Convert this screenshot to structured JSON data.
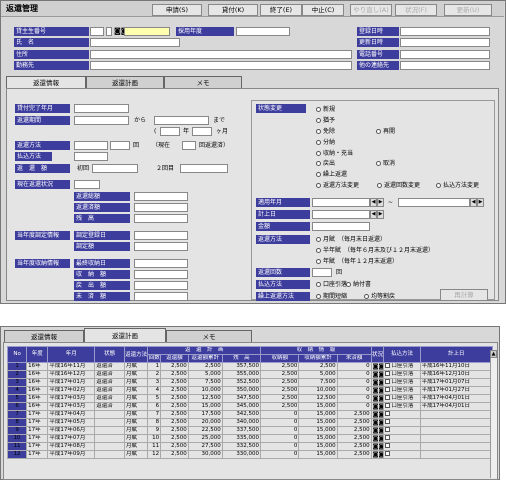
{
  "app": {
    "title": "返還管理"
  },
  "toolbar": {
    "apply": "申請(S)",
    "lend": "貸付(K)",
    "exit": "終了(E)",
    "cancel": "中止(C)",
    "redo": "やり直し(A)",
    "status": "状況(F)",
    "update": "更新(U)"
  },
  "header": {
    "student_no": "貸主生番号",
    "adoption_year": "採用年度",
    "name": "氏　名",
    "address": "住所",
    "workplace": "勤務先",
    "reg_date": "登録日時",
    "upd_date": "更新日時",
    "phone": "電話番号",
    "other_contact": "他の連絡先"
  },
  "tabs": [
    "返還情報",
    "返還計画",
    "メモ"
  ],
  "left": {
    "lend_end": "貸付完了年月",
    "period": "返還期間",
    "from": "から",
    "to": "まで",
    "year": "年",
    "month": "ヶ月",
    "method": "返還方法",
    "times_unit": "回",
    "current": "（現在",
    "current_suffix": "回返還済）",
    "pay_method": "払込方法",
    "amount": "返　還　額",
    "first": "初回",
    "second": "２回目",
    "status_head": "現在返還状況",
    "total": "返還総額",
    "paid": "返還済額",
    "balance": "残　高",
    "adjust_head": "当年度調定情報",
    "adjust_date": "調定登録日",
    "adjust_amt": "調定額",
    "collect_head": "当年度収納情報",
    "collect_date": "最終収納日",
    "collect_amt": "収　納　額",
    "refund_amt": "戻　出　額",
    "unpaid_amt": "未　済　額"
  },
  "right": {
    "change_head": "状態変更",
    "options": [
      "新規",
      "猶予",
      "免除",
      "再開",
      "分納",
      "収納・充当",
      "戻出",
      "取消",
      "繰上返還"
    ],
    "checks": [
      "返還方法変更",
      "返還回数変更",
      "払込方法変更"
    ],
    "apply_ym": "適用年月",
    "calc_date": "計上日",
    "amount": "金額",
    "method": "返還方法",
    "method_opts": [
      "月賦　（毎月末日返還）",
      "半年賦　（毎年６月末及び１２月末返還）",
      "年賦　（毎年１２月末返還）"
    ],
    "count": "返還回数",
    "count_unit": "回",
    "pay_method": "払込方法",
    "pay_opts": [
      "口座引落",
      "納付書"
    ],
    "early_method": "繰上返還方法",
    "early_opts": [
      "期間短縮",
      "均等割戻"
    ],
    "recalc": "再計算"
  },
  "grid": {
    "tabs": [
      "返還情報",
      "返還計画",
      "メモ"
    ],
    "head1": [
      "No",
      "年度",
      "年月",
      "状態",
      "返還方法",
      "返　還　計　画",
      "収　納　情　報",
      "状況",
      "払込方法",
      "計上日"
    ],
    "head2": [
      "回数",
      "返還額",
      "返還額累計",
      "残　高",
      "収納額",
      "収納額累計",
      "未済額"
    ],
    "rows": [
      [
        "1",
        "16年",
        "平成16年11月",
        "返還済",
        "月賦",
        "1",
        "2,500",
        "2,500",
        "357,500",
        "2,500",
        "2,500",
        "0",
        "口座引落",
        "平成16年11月10日"
      ],
      [
        "2",
        "16年",
        "平成16年12月",
        "返還済",
        "月賦",
        "2",
        "2,500",
        "5,000",
        "355,000",
        "2,500",
        "5,000",
        "0",
        "口座引落",
        "平成16年12月10日"
      ],
      [
        "3",
        "16年",
        "平成17年01月",
        "返還済",
        "月賦",
        "3",
        "2,500",
        "7,500",
        "352,500",
        "2,500",
        "7,500",
        "0",
        "口座引落",
        "平成17年01月07日"
      ],
      [
        "4",
        "16年",
        "平成17年02月",
        "返還済",
        "月賦",
        "4",
        "2,500",
        "10,000",
        "350,000",
        "2,500",
        "10,000",
        "0",
        "口座引落",
        "平成17年01月27日"
      ],
      [
        "5",
        "16年",
        "平成17年03月",
        "返還済",
        "月賦",
        "5",
        "2,500",
        "12,500",
        "347,500",
        "2,500",
        "12,500",
        "0",
        "口座引落",
        "平成17年04月01日"
      ],
      [
        "6",
        "16年",
        "平成17年03月",
        "返還済",
        "月賦",
        "6",
        "2,500",
        "15,000",
        "345,000",
        "2,500",
        "15,000",
        "0",
        "口座引落",
        "平成17年04月01日"
      ],
      [
        "7",
        "17年",
        "平成17年04月",
        "",
        "月賦",
        "7",
        "2,500",
        "17,500",
        "342,500",
        "0",
        "15,000",
        "2,500",
        "",
        ""
      ],
      [
        "8",
        "17年",
        "平成17年05月",
        "",
        "月賦",
        "8",
        "2,500",
        "20,000",
        "340,000",
        "0",
        "15,000",
        "2,500",
        "",
        ""
      ],
      [
        "9",
        "17年",
        "平成17年06月",
        "",
        "月賦",
        "9",
        "2,500",
        "22,500",
        "337,500",
        "0",
        "15,000",
        "2,500",
        "",
        ""
      ],
      [
        "10",
        "17年",
        "平成17年07月",
        "",
        "月賦",
        "10",
        "2,500",
        "25,000",
        "335,000",
        "0",
        "15,000",
        "2,500",
        "",
        ""
      ],
      [
        "11",
        "17年",
        "平成17年08月",
        "",
        "月賦",
        "11",
        "2,500",
        "27,500",
        "332,500",
        "0",
        "15,000",
        "2,500",
        "",
        ""
      ],
      [
        "12",
        "17年",
        "平成17年09月",
        "",
        "月賦",
        "12",
        "2,500",
        "30,000",
        "330,000",
        "0",
        "15,000",
        "2,500",
        "",
        ""
      ]
    ]
  }
}
